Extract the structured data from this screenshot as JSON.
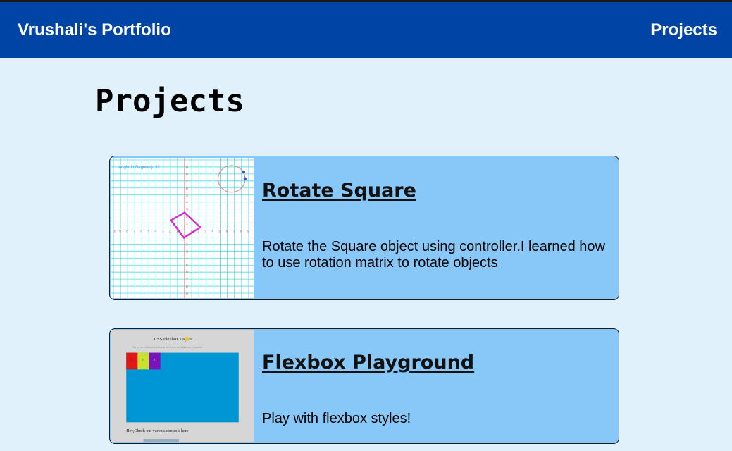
{
  "nav": {
    "brand": "Vrushali's Portfolio",
    "projects_link": "Projects"
  },
  "page": {
    "heading": "Projects"
  },
  "projects": [
    {
      "title": "Rotate Square",
      "description": "Rotate the Square object using controller.I learned how to use rotation matrix to rotate objects",
      "thumbnail": {
        "caption": "Angle(in Degrees): 32"
      }
    },
    {
      "title": "Flexbox Playground",
      "description": "Play with flexbox styles!",
      "thumbnail": {
        "header": "CSS Flexbox Layout",
        "subtext": "You can use following buttons to play with flexbox styles alignment and spacing",
        "footer": "Hey,Check out various controls here",
        "box_labels": [
          "1",
          "2",
          "3"
        ]
      }
    }
  ],
  "colors": {
    "navbar": "#0044a6",
    "page_background": "#e0f1fc",
    "card_background": "#88c8f8"
  }
}
